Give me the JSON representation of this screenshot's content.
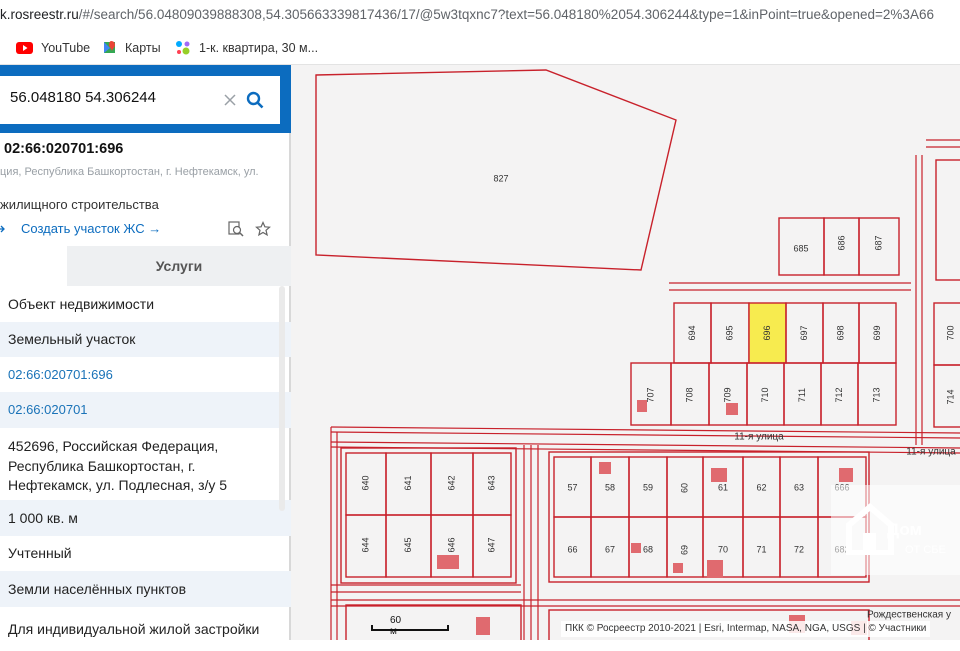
{
  "browser": {
    "url_domain": "k.rosreestr.ru",
    "url_rest": "/#/search/56.04809039888308,54.305663339817436/17/@5w3tqxnc7?text=56.048180%2054.306244&type=1&inPoint=true&opened=2%3A66",
    "bookmarks": [
      {
        "label": "YouTube",
        "icon": "youtube-icon"
      },
      {
        "label": "Карты",
        "icon": "maps-icon"
      },
      {
        "label": "1-к. квартира, 30 м...",
        "icon": "avito-icon"
      }
    ]
  },
  "panel": {
    "search_value": "56.048180 54.306244",
    "cadastral_title": "02:66:020701:696",
    "address_short": "ция, Республика Башкортостан, г. Нефтекамск, ул.",
    "purpose_short": "жилищного строительства",
    "create_link": "Создать участок ЖС →",
    "tab_services": "Услуги",
    "rows": [
      "Объект недвижимости",
      "Земельный участок",
      "02:66:020701:696",
      "02:66:020701",
      "452696, Российская Федерация,",
      "Республика Башкортостан, г.",
      "Нефтекамск, ул. Подлесная, з/у 5",
      "1 000 кв. м",
      "Учтенный",
      "Земли населённых пунктов",
      "Для индивидуальной жилой застройки"
    ]
  },
  "map": {
    "big_parcel": "827",
    "row_top": [
      "685",
      "686",
      "687"
    ],
    "row_mid": [
      "694",
      "695",
      "696",
      "697",
      "698",
      "699"
    ],
    "row_low": [
      "707",
      "708",
      "709",
      "710",
      "711",
      "712",
      "713"
    ],
    "right_col": [
      "700",
      "714"
    ],
    "street1": "11-я улица",
    "street2": "11-я улица",
    "street3": "Рождественская у",
    "block_a_top": [
      "640",
      "641",
      "642",
      "643"
    ],
    "block_a_bot": [
      "644",
      "645",
      "646",
      "647"
    ],
    "block_b_top": [
      "57",
      "58",
      "59",
      "60",
      "61",
      "62",
      "63",
      "666"
    ],
    "block_b_bot": [
      "66",
      "67",
      "68",
      "69",
      "70",
      "71",
      "72",
      "682"
    ],
    "scale_label": "60 м",
    "attribution": "ПКК © Росреестр 2010-2021 | Esri, Intermap, NASA, NGA, USGS | © Участники",
    "logo_line1": "Дом",
    "logo_line2": "ОТ СБЕ",
    "colors": {
      "parcel_line": "#c8212b",
      "highlight": "#f7eb4f",
      "panel_blue": "#0c6cbf"
    }
  }
}
